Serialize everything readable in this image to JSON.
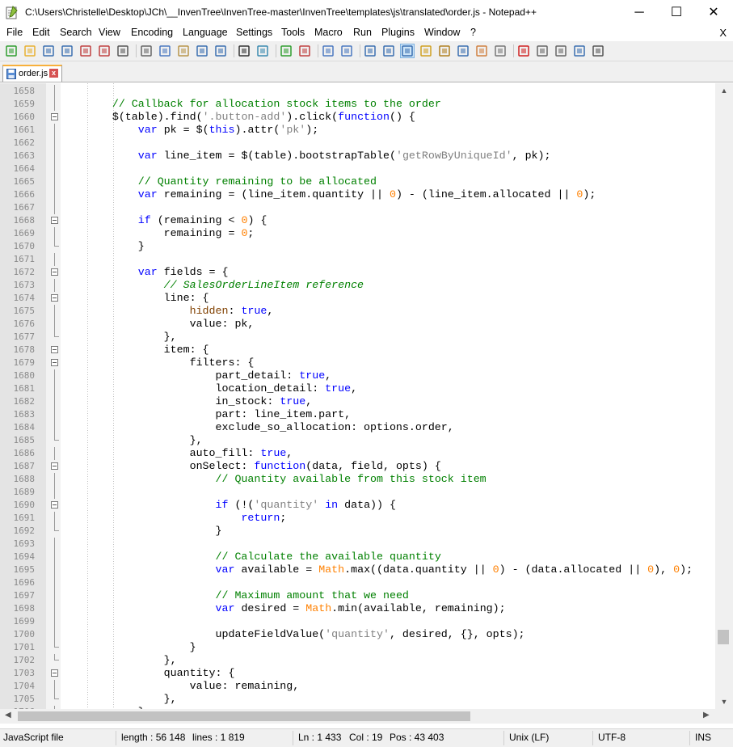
{
  "window": {
    "title": "C:\\Users\\Christelle\\Desktop\\JCh\\__InvenTree\\InvenTree-master\\InvenTree\\templates\\js\\translated\\order.js - Notepad++",
    "minimize": "─",
    "maximize": "☐",
    "close": "✕"
  },
  "menu": {
    "items": [
      "File",
      "Edit",
      "Search",
      "View",
      "Encoding",
      "Language",
      "Settings",
      "Tools",
      "Macro",
      "Run",
      "Plugins",
      "Window",
      "?"
    ],
    "close_label": "X"
  },
  "toolbar": {
    "icons": [
      "new-file-icon",
      "open-file-icon",
      "save-icon",
      "save-all-icon",
      "close-icon",
      "close-all-icon",
      "print-icon",
      "cut-icon",
      "copy-icon",
      "paste-icon",
      "undo-icon",
      "redo-icon",
      "find-icon",
      "replace-icon",
      "zoom-in-icon",
      "zoom-out-icon",
      "sync-vertical-icon",
      "sync-horizontal-icon",
      "word-wrap-icon",
      "show-all-chars-icon",
      "indent-guide-icon",
      "udl-icon",
      "doc-map-icon",
      "function-list-icon",
      "folder-workspace-icon",
      "monitoring-icon",
      "record-macro-icon",
      "stop-macro-icon",
      "play-macro-icon",
      "run-macro-multiple-icon",
      "save-macro-icon"
    ]
  },
  "tab": {
    "label": "order.js",
    "close": "x"
  },
  "editor": {
    "lines": [
      {
        "n": "1658",
        "fold": "line",
        "html": ""
      },
      {
        "n": "1659",
        "fold": "line",
        "html": "        <span class=\"cm\">// Callback for allocation stock items to the order</span>"
      },
      {
        "n": "1660",
        "fold": "box",
        "html": "        $(table).find(<span class=\"st\">'.button-add'</span>).click(<span class=\"kw\">function</span>() {"
      },
      {
        "n": "1661",
        "fold": "line",
        "html": "            <span class=\"kw\">var</span> pk = $(<span class=\"kw\">this</span>).attr(<span class=\"st\">'pk'</span>);"
      },
      {
        "n": "1662",
        "fold": "line",
        "html": ""
      },
      {
        "n": "1663",
        "fold": "line",
        "html": "            <span class=\"kw\">var</span> line_item = $(table).bootstrapTable(<span class=\"st\">'getRowByUniqueId'</span>, pk);"
      },
      {
        "n": "1664",
        "fold": "line",
        "html": ""
      },
      {
        "n": "1665",
        "fold": "line",
        "html": "            <span class=\"cm\">// Quantity remaining to be allocated</span>"
      },
      {
        "n": "1666",
        "fold": "line",
        "html": "            <span class=\"kw\">var</span> remaining = (line_item.quantity || <span class=\"nu\">0</span>) - (line_item.allocated || <span class=\"nu\">0</span>);"
      },
      {
        "n": "1667",
        "fold": "line",
        "html": ""
      },
      {
        "n": "1668",
        "fold": "box",
        "html": "            <span class=\"kw\">if</span> (remaining &lt; <span class=\"nu\">0</span>) {"
      },
      {
        "n": "1669",
        "fold": "line",
        "html": "                remaining = <span class=\"nu\">0</span>;"
      },
      {
        "n": "1670",
        "fold": "end",
        "html": "            }"
      },
      {
        "n": "1671",
        "fold": "line",
        "html": ""
      },
      {
        "n": "1672",
        "fold": "box",
        "html": "            <span class=\"kw\">var</span> fields = {"
      },
      {
        "n": "1673",
        "fold": "line",
        "html": "                <span class=\"cm\"><i>// SalesOrderLineItem reference</i></span>"
      },
      {
        "n": "1674",
        "fold": "box",
        "html": "                line: {"
      },
      {
        "n": "1675",
        "fold": "line",
        "html": "                    <span style=\"color:#804000\">hidden</span>: <span class=\"kw\">true</span>,"
      },
      {
        "n": "1676",
        "fold": "line",
        "html": "                    value: pk,"
      },
      {
        "n": "1677",
        "fold": "end",
        "html": "                },"
      },
      {
        "n": "1678",
        "fold": "box",
        "html": "                item: {"
      },
      {
        "n": "1679",
        "fold": "box",
        "html": "                    filters: {"
      },
      {
        "n": "1680",
        "fold": "line",
        "html": "                        part_detail: <span class=\"kw\">true</span>,"
      },
      {
        "n": "1681",
        "fold": "line",
        "html": "                        location_detail: <span class=\"kw\">true</span>,"
      },
      {
        "n": "1682",
        "fold": "line",
        "html": "                        in_stock: <span class=\"kw\">true</span>,"
      },
      {
        "n": "1683",
        "fold": "line",
        "html": "                        part: line_item.part,"
      },
      {
        "n": "1684",
        "fold": "line",
        "html": "                        exclude_so_allocation: options.order,"
      },
      {
        "n": "1685",
        "fold": "end",
        "html": "                    },"
      },
      {
        "n": "1686",
        "fold": "line",
        "html": "                    auto_fill: <span class=\"kw\">true</span>,"
      },
      {
        "n": "1687",
        "fold": "box",
        "html": "                    onSelect: <span class=\"kw\">function</span>(data, field, opts) {"
      },
      {
        "n": "1688",
        "fold": "line",
        "html": "                        <span class=\"cm\">// Quantity available from this stock item</span>"
      },
      {
        "n": "1689",
        "fold": "line",
        "html": ""
      },
      {
        "n": "1690",
        "fold": "box",
        "html": "                        <span class=\"kw\">if</span> (!(<span class=\"st\">'quantity'</span> <span class=\"kw\">in</span> data)) {"
      },
      {
        "n": "1691",
        "fold": "line",
        "html": "                            <span class=\"kw\">return</span>;"
      },
      {
        "n": "1692",
        "fold": "end",
        "html": "                        }"
      },
      {
        "n": "1693",
        "fold": "line",
        "html": ""
      },
      {
        "n": "1694",
        "fold": "line",
        "html": "                        <span class=\"cm\">// Calculate the available quantity</span>"
      },
      {
        "n": "1695",
        "fold": "line",
        "html": "                        <span class=\"kw\">var</span> available = <span class=\"nu\">Math</span>.max((data.quantity || <span class=\"nu\">0</span>) - (data.allocated || <span class=\"nu\">0</span>), <span class=\"nu\">0</span>);"
      },
      {
        "n": "1696",
        "fold": "line",
        "html": ""
      },
      {
        "n": "1697",
        "fold": "line",
        "html": "                        <span class=\"cm\">// Maximum amount that we need</span>"
      },
      {
        "n": "1698",
        "fold": "line",
        "html": "                        <span class=\"kw\">var</span> desired = <span class=\"nu\">Math</span>.min(available, remaining);"
      },
      {
        "n": "1699",
        "fold": "line",
        "html": ""
      },
      {
        "n": "1700",
        "fold": "line",
        "html": "                        updateFieldValue(<span class=\"st\">'quantity'</span>, desired, {}, opts);"
      },
      {
        "n": "1701",
        "fold": "end",
        "html": "                    }"
      },
      {
        "n": "1702",
        "fold": "end",
        "html": "                },"
      },
      {
        "n": "1703",
        "fold": "box",
        "html": "                quantity: {"
      },
      {
        "n": "1704",
        "fold": "line",
        "html": "                    value: remaining,"
      },
      {
        "n": "1705",
        "fold": "end",
        "html": "                },"
      },
      {
        "n": "1706",
        "fold": "line",
        "html": "            };"
      }
    ]
  },
  "statusbar": {
    "file_type": "JavaScript file",
    "length": "length : 56 148",
    "lines": "lines : 1 819",
    "ln": "Ln : 1 433",
    "col": "Col : 19",
    "pos": "Pos : 43 403",
    "eol": "Unix (LF)",
    "encoding": "UTF-8",
    "mode": "INS"
  }
}
